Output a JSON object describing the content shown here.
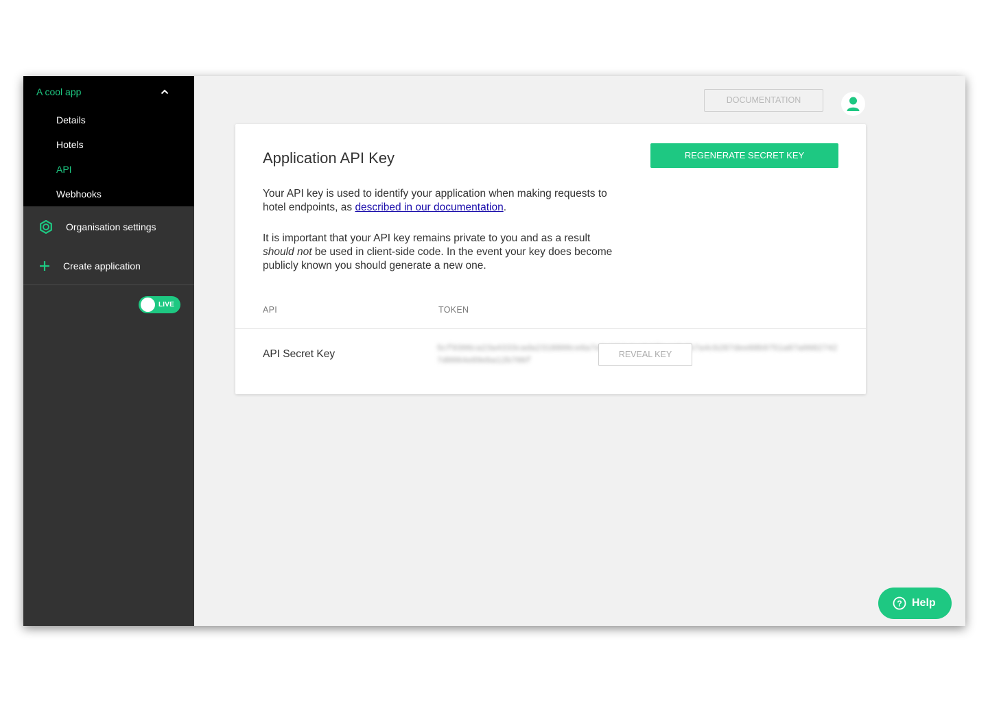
{
  "sidebar": {
    "app_name": "A cool app",
    "nav": [
      {
        "label": "Details",
        "active": false
      },
      {
        "label": "Hotels",
        "active": false
      },
      {
        "label": "API",
        "active": true
      },
      {
        "label": "Webhooks",
        "active": false
      }
    ],
    "org_settings_label": "Organisation settings",
    "create_app_label": "Create application",
    "toggle": {
      "label": "LIVE",
      "state": "on"
    }
  },
  "header": {
    "documentation_label": "DOCUMENTATION"
  },
  "card": {
    "title": "Application API Key",
    "regenerate_label": "REGENERATE SECRET KEY",
    "para1_start": "Your API key is used to identify your application when making requests to hotel endpoints, as ",
    "para1_link": "described in our documentation",
    "para1_end": ".",
    "para2_em": "should not",
    "para2_start": "It is important that your API key remains private to you and as a result ",
    "para2_end": " be used in client-side code. In the event your key does become publicly known you should generate a new one.",
    "table": {
      "col_api": "API",
      "col_token": "TOKEN",
      "row_label": "API Secret Key",
      "token_masked": "5cf9306ca23a4333cada2318800ce6a7e9a07da5c2b5f9c13b7b7a4cb287dee88b9751a87a06827427d0064e09eba12b706f",
      "reveal_label": "REVEAL KEY"
    }
  },
  "help": {
    "label": "Help"
  },
  "colors": {
    "accent": "#1ec882",
    "sidebar_dark": "#333333",
    "sidebar_black": "#000000"
  }
}
